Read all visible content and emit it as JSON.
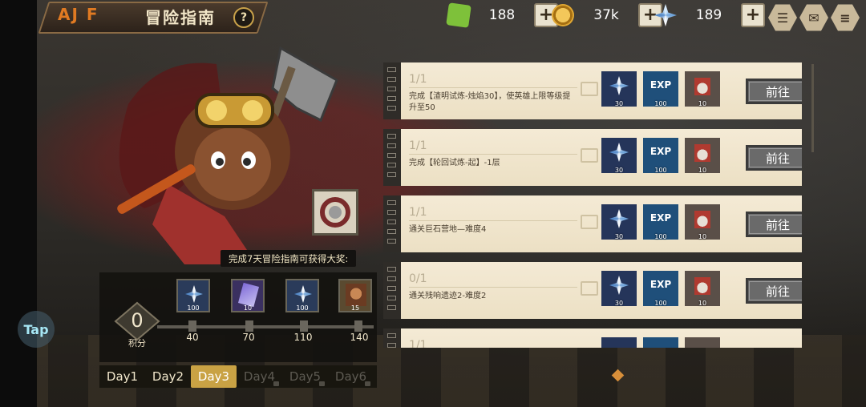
{
  "header": {
    "title": "冒险指南",
    "help_icon": "question-icon",
    "help_glyph": "?",
    "logo_text": "AJ F"
  },
  "currencies": [
    {
      "icon": "green-cube-icon",
      "value": "188",
      "color": "#7ec13a"
    },
    {
      "icon": "gold-coin-icon",
      "value": "37k",
      "color": "#d7a22a"
    },
    {
      "icon": "crystal-icon",
      "value": "189",
      "color": "#9fc8ef"
    }
  ],
  "plus_glyph": "+",
  "menu_buttons": [
    {
      "icon": "chat-icon",
      "glyph": "☰"
    },
    {
      "icon": "mail-icon",
      "glyph": "✉"
    },
    {
      "icon": "menu-list-icon",
      "glyph": "≡"
    }
  ],
  "reward": {
    "tip": "完成7天冒险指南可获得大奖:",
    "score_value": "0",
    "score_label": "积分",
    "milestones": [
      {
        "points": "40",
        "count": "100",
        "icon": "crystal-icon"
      },
      {
        "points": "70",
        "count": "10",
        "icon": "ticket-card-icon"
      },
      {
        "points": "110",
        "count": "100",
        "icon": "crystal-icon"
      },
      {
        "points": "140",
        "count": "15",
        "icon": "hero-portrait-icon"
      }
    ]
  },
  "days": [
    {
      "label": "Day1",
      "state": "normal"
    },
    {
      "label": "Day2",
      "state": "normal"
    },
    {
      "label": "Day3",
      "state": "active"
    },
    {
      "label": "Day4",
      "state": "locked"
    },
    {
      "label": "Day5",
      "state": "locked"
    },
    {
      "label": "Day6",
      "state": "locked"
    }
  ],
  "tap_label": "Tap",
  "tasks": [
    {
      "progress": "1/1",
      "desc": "完成【渣明试炼-烛焰30】，使英雄上限等级提升至50",
      "button": "前往",
      "rewards": [
        {
          "icon": "crystal-icon",
          "count": "30"
        },
        {
          "icon": "exp-icon",
          "count": "100",
          "label": "EXP"
        },
        {
          "icon": "medal-icon",
          "count": "10"
        }
      ]
    },
    {
      "progress": "1/1",
      "desc": "完成【轮回试炼-起】-1层",
      "button": "前往",
      "rewards": [
        {
          "icon": "crystal-icon",
          "count": "30"
        },
        {
          "icon": "exp-icon",
          "count": "100",
          "label": "EXP"
        },
        {
          "icon": "medal-icon",
          "count": "10"
        }
      ]
    },
    {
      "progress": "1/1",
      "desc": "通关巨石营地—难度4",
      "button": "前往",
      "rewards": [
        {
          "icon": "crystal-icon",
          "count": "30"
        },
        {
          "icon": "exp-icon",
          "count": "100",
          "label": "EXP"
        },
        {
          "icon": "medal-icon",
          "count": "10"
        }
      ]
    },
    {
      "progress": "0/1",
      "desc": "通关残响遗迹2-难度2",
      "button": "前往",
      "rewards": [
        {
          "icon": "crystal-icon",
          "count": "30"
        },
        {
          "icon": "exp-icon",
          "count": "100",
          "label": "EXP"
        },
        {
          "icon": "medal-icon",
          "count": "10"
        }
      ]
    },
    {
      "progress": "1/1",
      "desc": "",
      "button": "",
      "rewards": [
        {
          "icon": "crystal-icon",
          "count": ""
        },
        {
          "icon": "exp-icon",
          "count": "",
          "label": ""
        },
        {
          "icon": "medal-icon",
          "count": ""
        }
      ]
    }
  ]
}
